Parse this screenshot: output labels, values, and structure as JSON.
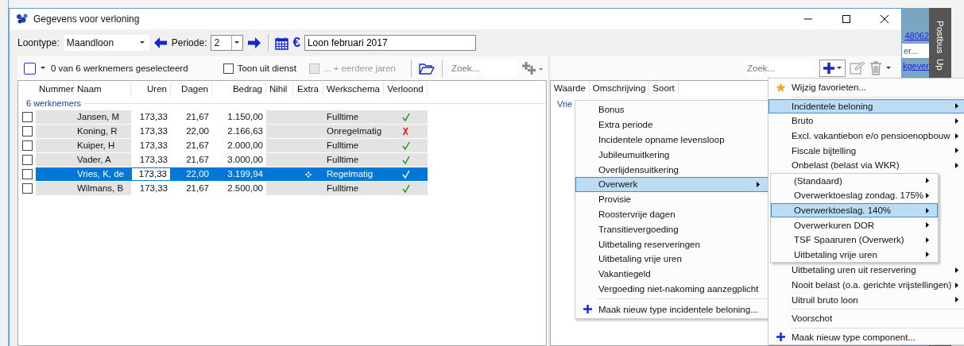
{
  "window": {
    "title": "Gegevens voor verloning"
  },
  "toolbar": {
    "loontype_label": "Loontype:",
    "loontype_value": "Maandloon",
    "periode_label": "Periode:",
    "periode_value": "2",
    "currency_symbol": "€",
    "description_value": "Loon februari 2017"
  },
  "employees": {
    "select_all": {
      "checked": false
    },
    "selection_summary": "0 van 6 werknemers geselecteerd",
    "show_inactive": {
      "label": "Toon uit dienst",
      "checked": false,
      "disabled": false
    },
    "earlier_years": {
      "label": "... + eerdere jaren",
      "checked": false,
      "disabled": true
    },
    "search": {
      "placeholder": "Zoek..."
    },
    "columns": [
      "Nummer",
      "Naam",
      "Uren",
      "Dagen",
      "Bedrag",
      "Nihil",
      "Extra",
      "Werkschema",
      "Verloond"
    ],
    "group_label": "6 werknemers",
    "rows": [
      {
        "naam": "Jansen, M",
        "uren": "173,33",
        "dagen": "21,67",
        "bedrag": "1.150,00",
        "extra": false,
        "werkschema": "Fulltime",
        "verloond": true,
        "checked": false,
        "selected": false
      },
      {
        "naam": "Koning, R",
        "uren": "173,33",
        "dagen": "22,00",
        "bedrag": "2.166,63",
        "extra": false,
        "werkschema": "Onregelmatig",
        "verloond": false,
        "checked": false,
        "selected": false
      },
      {
        "naam": "Kuiper, H",
        "uren": "173,33",
        "dagen": "21,67",
        "bedrag": "2.000,00",
        "extra": false,
        "werkschema": "Fulltime",
        "verloond": true,
        "checked": false,
        "selected": false
      },
      {
        "naam": "Vader, A",
        "uren": "173,33",
        "dagen": "21,67",
        "bedrag": "3.000,00",
        "extra": false,
        "werkschema": "Fulltime",
        "verloond": true,
        "checked": false,
        "selected": false
      },
      {
        "naam": "Vries, K, de",
        "uren": "173,33",
        "dagen": "22,00",
        "bedrag": "3.199,94",
        "extra": true,
        "werkschema": "Regelmatig",
        "verloond": true,
        "checked": false,
        "selected": true
      },
      {
        "naam": "Wilmans, B",
        "uren": "173,33",
        "dagen": "21,67",
        "bedrag": "2.500,00",
        "extra": false,
        "werkschema": "Fulltime",
        "verloond": true,
        "checked": false,
        "selected": false
      }
    ]
  },
  "components": {
    "search": {
      "placeholder": "Zoek..."
    },
    "columns": [
      "Waarde",
      "Omschrijving",
      "Soort"
    ],
    "first_value": "Vrie"
  },
  "menu_incidenteel": [
    {
      "kind": "item",
      "label": "Bonus",
      "selected": false
    },
    {
      "kind": "item",
      "label": "Extra periode",
      "selected": false
    },
    {
      "kind": "item",
      "label": "Incidentele opname levensloop",
      "selected": false
    },
    {
      "kind": "item",
      "label": "Jubileumuitkering",
      "selected": false
    },
    {
      "kind": "item",
      "label": "Overlijdensuitkering",
      "selected": false
    },
    {
      "kind": "submenu",
      "label": "Overwerk",
      "selected": true
    },
    {
      "kind": "item",
      "label": "Provisie",
      "selected": false
    },
    {
      "kind": "item",
      "label": "Roostervrije dagen",
      "selected": false
    },
    {
      "kind": "item",
      "label": "Transitievergoeding",
      "selected": false
    },
    {
      "kind": "item",
      "label": "Uitbetaling reserveringen",
      "selected": false
    },
    {
      "kind": "item",
      "label": "Uitbetaling vrije uren",
      "selected": false
    },
    {
      "kind": "item",
      "label": "Vakantiegeld",
      "selected": false
    },
    {
      "kind": "item",
      "label": "Vergoeding niet-nakoming aanzegplicht",
      "selected": false
    },
    {
      "kind": "separator"
    },
    {
      "kind": "action",
      "label": "Maak nieuw type incidentele beloning...",
      "selected": false
    }
  ],
  "menu_component": [
    {
      "kind": "favorite",
      "label": "Wijzig favorieten...",
      "selected": false
    },
    {
      "kind": "separator"
    },
    {
      "kind": "submenu",
      "label": "Incidentele beloning",
      "selected": true
    },
    {
      "kind": "submenu",
      "label": "Bruto",
      "selected": false
    },
    {
      "kind": "submenu",
      "label": "Excl. vakantiebon e/o pensioenopbouw",
      "selected": false
    },
    {
      "kind": "submenu",
      "label": "Fiscale bijtelling",
      "selected": false
    },
    {
      "kind": "submenu",
      "label": "Onbelast (belast via WKR)",
      "selected": false
    },
    {
      "kind": "flyout",
      "children": [
        {
          "kind": "submenu",
          "label": "(Standaard)",
          "selected": false
        },
        {
          "kind": "submenu",
          "label": "Overwerktoeslag zondag. 175%",
          "selected": false
        },
        {
          "kind": "submenu",
          "label": "Overwerktoeslag. 140%",
          "selected": true
        },
        {
          "kind": "submenu",
          "label": "Overwerkuren DOR",
          "selected": false
        },
        {
          "kind": "submenu",
          "label": "TSF Spaaruren (Overwerk)",
          "selected": false
        },
        {
          "kind": "submenu",
          "label": "Uitbetaling vrije uren",
          "selected": false
        }
      ]
    },
    {
      "kind": "submenu",
      "label": "Uitbetaling uren uit reservering",
      "selected": false
    },
    {
      "kind": "submenu",
      "label": "Nooit belast (o.a. gerichte vrijstellingen)",
      "selected": false
    },
    {
      "kind": "submenu",
      "label": "Uitruil bruto loon",
      "selected": false
    },
    {
      "kind": "separator"
    },
    {
      "kind": "item",
      "label": "Voorschot",
      "selected": false
    },
    {
      "kind": "separator"
    },
    {
      "kind": "action",
      "label": "Maak nieuw type component...",
      "selected": false
    }
  ],
  "background_window": {
    "link_1": "48062",
    "field_value": "er...",
    "link_2": "kgever",
    "side_tabs": [
      "Postbus",
      "Up"
    ]
  }
}
